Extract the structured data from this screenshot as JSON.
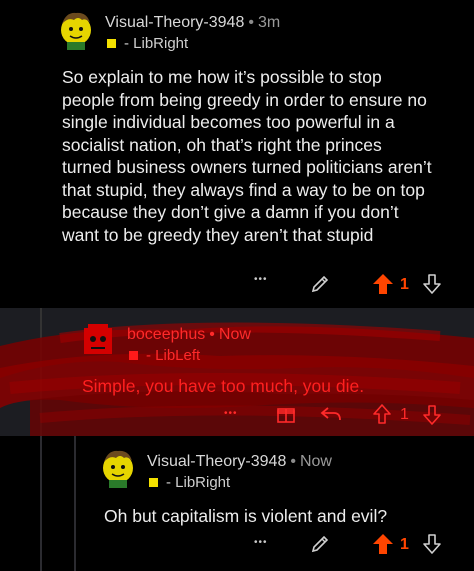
{
  "comments": [
    {
      "author": "Visual-Theory-3948",
      "separator": "•",
      "time": "3m",
      "flair": "- LibRight",
      "body": "So explain to me how it’s possible to stop people from being greedy in order to ensure no single individual becomes too powerful in a socialist nation, oh that’s right the princes turned business owners turned politicians aren’t that stupid, they always find a way to be on top because they don’t give a damn if you don’t want to be greedy they aren’t that stupid",
      "more": "•••",
      "votes": "1",
      "upvoted": true
    },
    {
      "author": "boceephus",
      "separator": "•",
      "time": "Now",
      "flair": "- LibLeft",
      "body": "Simple, you have too much, you die.",
      "more": "•••",
      "votes": "1"
    },
    {
      "author": "Visual-Theory-3948",
      "separator": "•",
      "time": "Now",
      "flair": "- LibRight",
      "body": "Oh but capitalism is violent and evil?",
      "more": "•••",
      "votes": "1",
      "upvoted": true
    }
  ],
  "colors": {
    "background": "#000000",
    "highlight_bg": "#1c1d22",
    "upvote": "#ff4500",
    "libright_flair": "#f4e100",
    "scribble_red": "#e00000"
  },
  "icons": [
    "avatar",
    "edit-icon",
    "upvote-icon",
    "downvote-icon",
    "award-icon",
    "reply-icon",
    "more-icon"
  ]
}
